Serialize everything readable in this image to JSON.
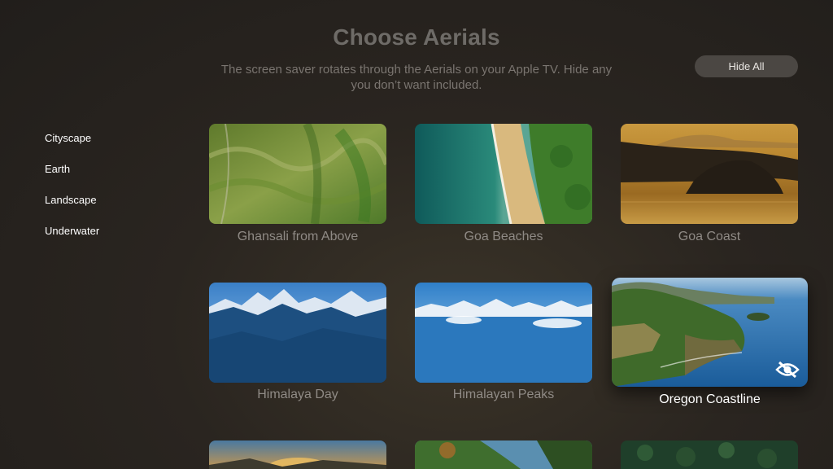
{
  "header": {
    "title": "Choose Aerials",
    "subtitle": "The screen saver rotates through the Aerials on your Apple TV. Hide any you don’t want included.",
    "hide_all_label": "Hide All"
  },
  "sidebar": {
    "items": [
      {
        "label": "Cityscape"
      },
      {
        "label": "Earth"
      },
      {
        "label": "Landscape"
      },
      {
        "label": "Underwater"
      }
    ]
  },
  "grid": {
    "items": [
      {
        "label": "Ghansali from Above"
      },
      {
        "label": "Goa Beaches"
      },
      {
        "label": "Goa Coast"
      },
      {
        "label": "Himalaya Day"
      },
      {
        "label": "Himalayan Peaks"
      },
      {
        "label": "Oregon Coastline",
        "focused": true,
        "hidden": true
      }
    ]
  },
  "colors": {
    "background": "#2a2520",
    "title": "#6e6b67",
    "button_bg": "#4b4743"
  }
}
